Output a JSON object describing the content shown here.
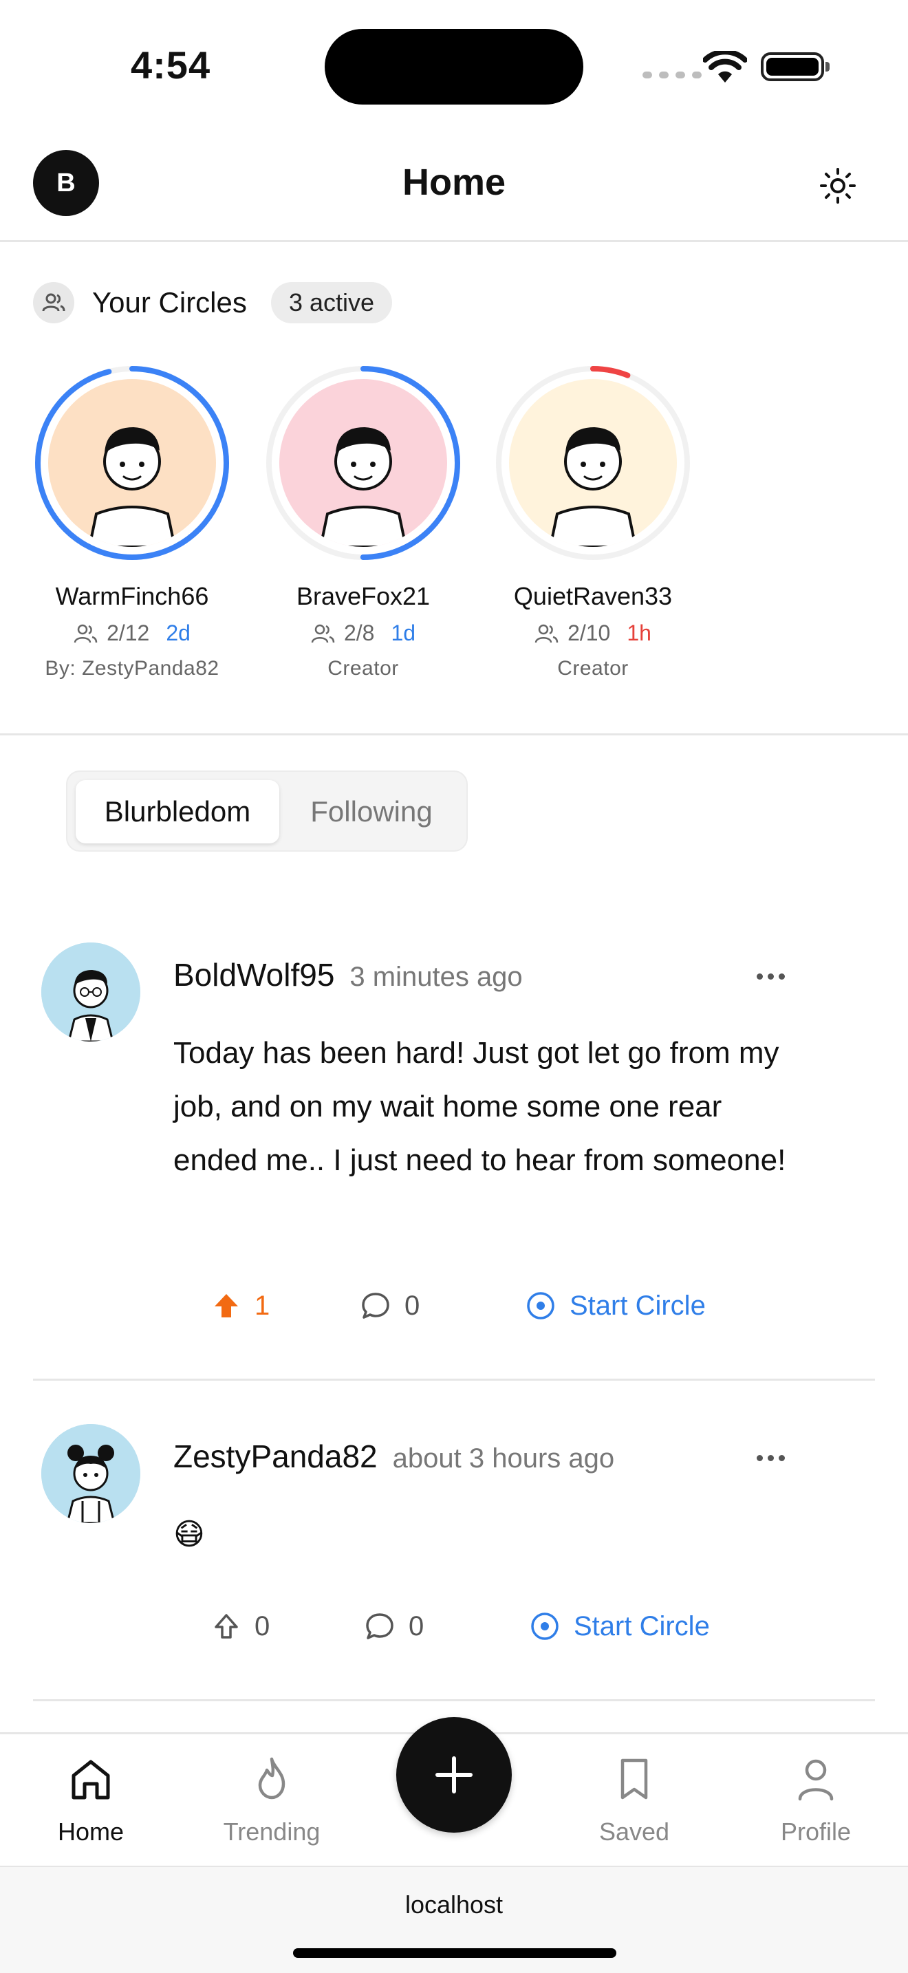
{
  "status_bar": {
    "time": "4:54"
  },
  "header": {
    "avatar_initial": "B",
    "title": "Home"
  },
  "circles": {
    "title": "Your Circles",
    "active_badge": "3 active",
    "items": [
      {
        "name": "WarmFinch66",
        "members": "2/12",
        "time_left": "2d",
        "subtitle": "By: ZestyPanda82",
        "ring_color": "#3b82f6",
        "progress": 0.96,
        "face_bg": "#fde0c4"
      },
      {
        "name": "BraveFox21",
        "members": "2/8",
        "time_left": "1d",
        "subtitle": "Creator",
        "ring_color": "#3b82f6",
        "progress": 0.5,
        "face_bg": "#fbd3da"
      },
      {
        "name": "QuietRaven33",
        "members": "2/10",
        "time_left": "1h",
        "subtitle": "Creator",
        "ring_color": "#ef4444",
        "progress": 0.06,
        "face_bg": "#fff3dc"
      }
    ]
  },
  "tabs": {
    "active": "Blurbledom",
    "inactive": "Following"
  },
  "posts": [
    {
      "user": "BoldWolf95",
      "time": "3 minutes ago",
      "body": "Today has been hard!  Just got let go from my job, and on my wait home some one rear ended me.. I just need to hear from someone!",
      "upvotes": "1",
      "comments": "0",
      "start_label": "Start Circle"
    },
    {
      "user": "ZestyPanda82",
      "time": "about 3 hours ago",
      "body": "😷",
      "upvotes": "0",
      "comments": "0",
      "start_label": "Start Circle"
    }
  ],
  "bottom_nav": {
    "home": "Home",
    "trending": "Trending",
    "saved": "Saved",
    "profile": "Profile"
  },
  "browser": {
    "url": "localhost"
  }
}
